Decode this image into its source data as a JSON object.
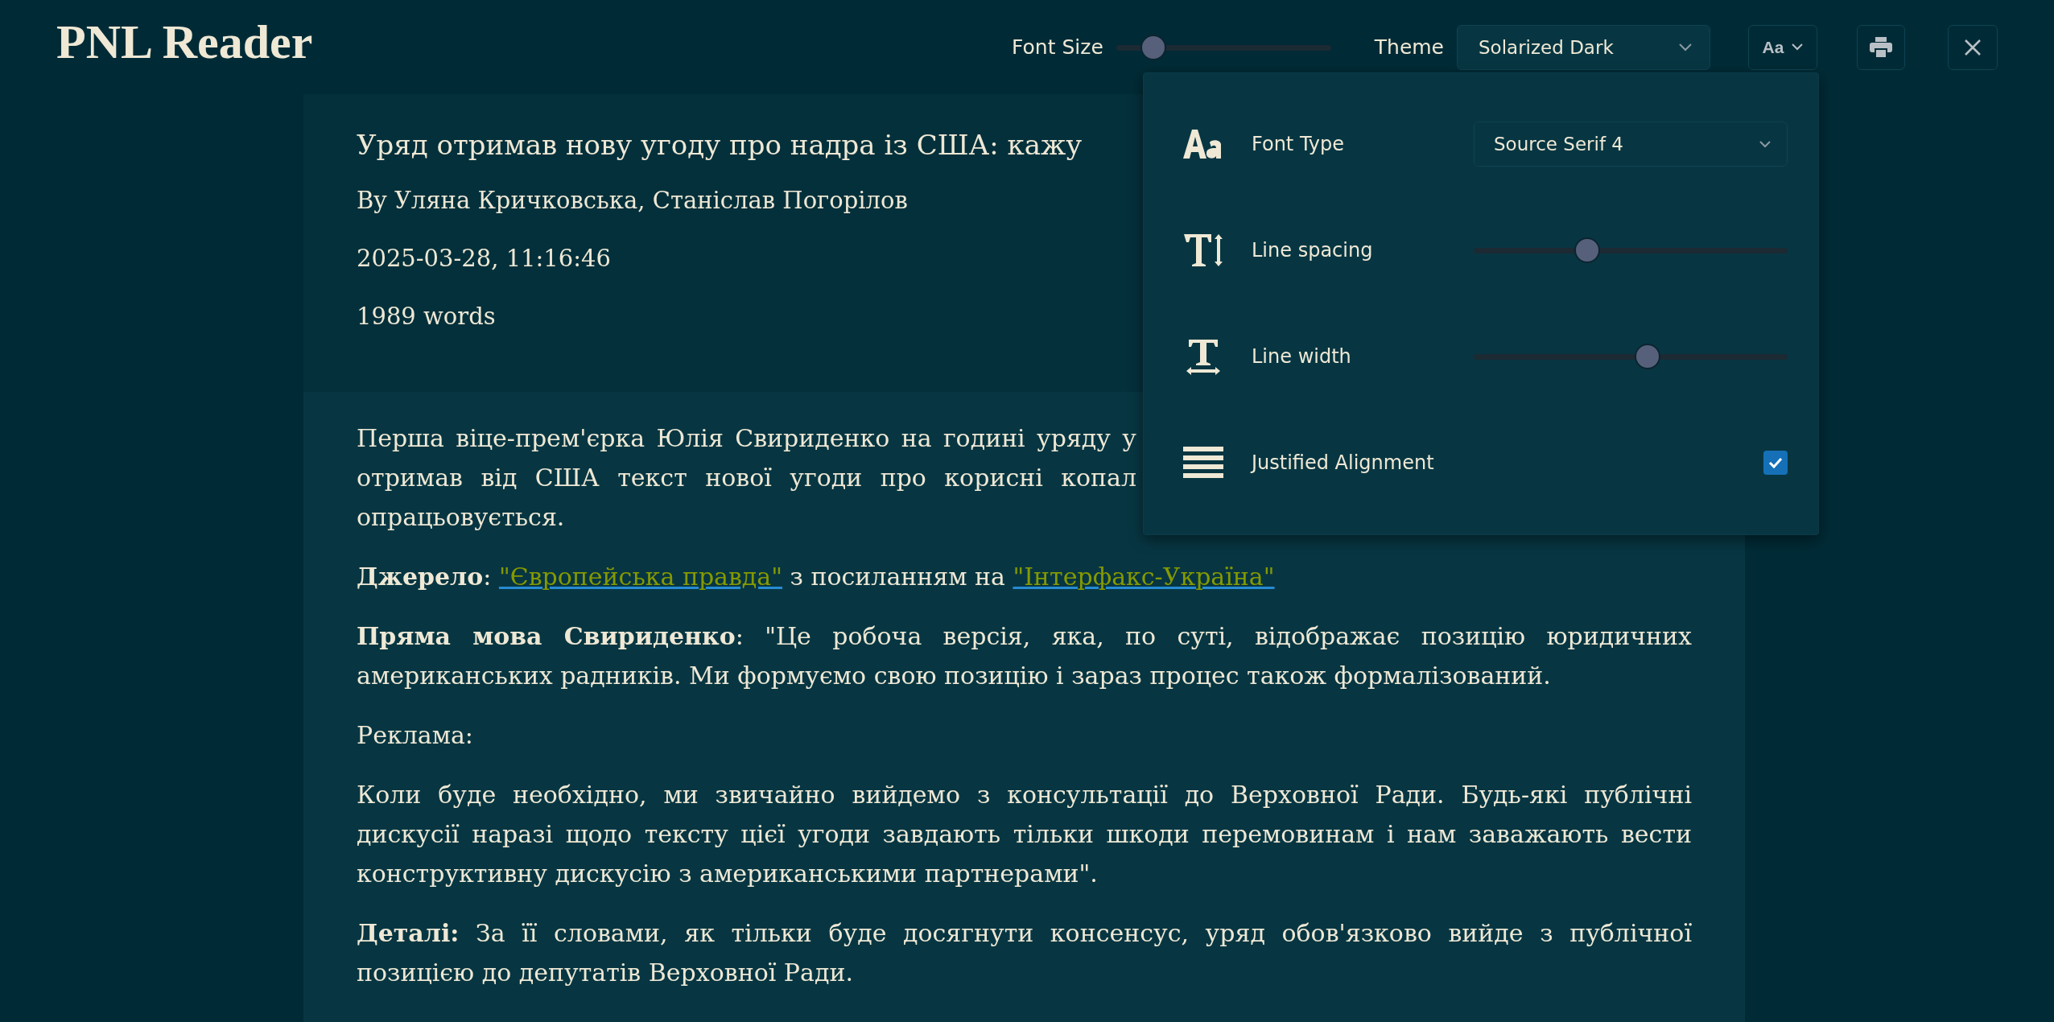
{
  "app_title": "PNL Reader",
  "toolbar": {
    "font_size": {
      "label": "Font Size",
      "level": 0.13
    },
    "theme": {
      "label": "Theme",
      "value": "Solarized Dark"
    },
    "font_button": {
      "label": "Aa",
      "expanded": true
    }
  },
  "settings_panel": {
    "rows": [
      {
        "kind": "select",
        "label": "Font Type",
        "value": "Source Serif 4"
      },
      {
        "kind": "slider",
        "label": "Line spacing",
        "level": 0.35
      },
      {
        "kind": "slider",
        "label": "Line width",
        "level": 0.56
      },
      {
        "kind": "checkbox",
        "label": "Justified Alignment",
        "checked": true
      }
    ]
  },
  "article": {
    "title": "Уряд отримав нову угоду про надра із США: кажу",
    "byline": "By Уляна Кричковська, Станіслав Погорілов",
    "date": "2025-03-28, 11:16:46",
    "word_count": "1989 words",
    "paragraphs": [
      {
        "kind": "lines",
        "lines": [
          "Перша віце-прем'єрка Юлія Свириденко на годині уряду у",
          "отримав від США текст нової угоди про корисні копал",
          "опрацьовується."
        ]
      },
      {
        "kind": "segments",
        "segments": [
          {
            "kind": "plain",
            "text": "**Джерело**: "
          },
          {
            "kind": "link",
            "text": "\"Європейська правда\""
          },
          {
            "kind": "plain",
            "text": " з посиланням на "
          },
          {
            "kind": "link",
            "text": "\"Інтерфакс-Україна\""
          }
        ]
      },
      {
        "kind": "text",
        "text": "**Пряма мова Свириденко**: \"Це робоча версія, яка, по суті, відображає позицію юридичних американських радників. Ми формуємо свою позицію і зараз процес також формалізований."
      },
      {
        "kind": "text",
        "text": "Реклама:"
      },
      {
        "kind": "text",
        "text": "Коли буде необхідно, ми звичайно вийдемо з консультації до Верховної Ради. Будь-які публічні дискусії наразі щодо тексту цієї угоди завдають тільки шкоди перемовинам і нам заважають вести конструктивну дискусію з американськими партнерами\"."
      },
      {
        "kind": "text",
        "text": "**Деталі:** За її словами, як тільки буде досягнути консенсус, уряд обов'язково вийде з публічної позицією до депутатів Верховної Ради."
      }
    ]
  }
}
